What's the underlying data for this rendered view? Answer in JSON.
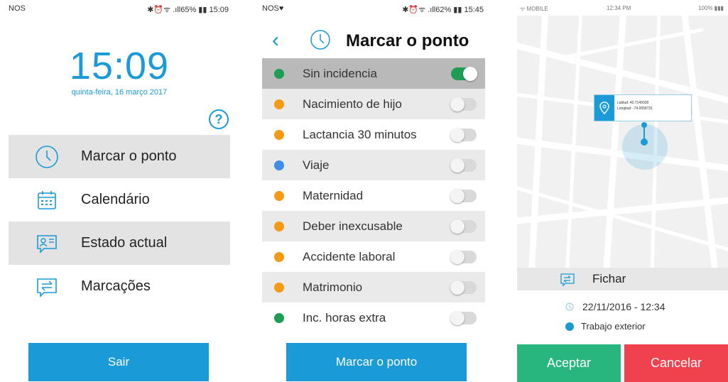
{
  "colors": {
    "accent": "#1a9ad6",
    "green": "#1f9d55",
    "orange": "#f59a14",
    "blue_dot": "#3e8eea",
    "accept": "#29b57e",
    "cancel": "#f0414f"
  },
  "phone1": {
    "status": {
      "carrier": "NOS",
      "right": "✱⏰ᯤ .ıll65% ▮▮ 15:09"
    },
    "time": "15:09",
    "date": "quinta-feira, 16 março 2017",
    "help_label": "?",
    "menu": [
      {
        "label": "Marcar o ponto",
        "icon": "clock-icon"
      },
      {
        "label": "Calendário",
        "icon": "calendar-icon"
      },
      {
        "label": "Estado actual",
        "icon": "user-card-icon"
      },
      {
        "label": "Marcações",
        "icon": "swap-icon"
      }
    ],
    "exit_label": "Sair"
  },
  "phone2": {
    "status": {
      "carrier": "NOS♥",
      "right": "✱⏰ᯤ .ıll62% ▮▮ 15:45"
    },
    "back_label": "‹",
    "title": "Marcar o ponto",
    "options": [
      {
        "label": "Sin incidencia",
        "color": "#1f9d55",
        "on": true
      },
      {
        "label": "Nacimiento de hijo",
        "color": "#f59a14",
        "on": false
      },
      {
        "label": "Lactancia 30 minutos",
        "color": "#f59a14",
        "on": false
      },
      {
        "label": "Viaje",
        "color": "#3e8eea",
        "on": false
      },
      {
        "label": "Maternidad",
        "color": "#f59a14",
        "on": false
      },
      {
        "label": "Deber inexcusable",
        "color": "#f59a14",
        "on": false
      },
      {
        "label": "Accidente laboral",
        "color": "#f59a14",
        "on": false
      },
      {
        "label": "Matrimonio",
        "color": "#f59a14",
        "on": false
      },
      {
        "label": "Inc. horas extra",
        "color": "#1f9d55",
        "on": false
      }
    ],
    "submit_label": "Marcar o ponto"
  },
  "phone3": {
    "status": {
      "carrier": "ᯤ MOBILE",
      "time": "12:34 PM",
      "battery": "100% ▮▮▮"
    },
    "popup": {
      "lat": "Latitud: 40.7140028",
      "lng": "Longitud: -74.0058731"
    },
    "fichar_label": "Fichar",
    "timestamp": "22/11/2016 - 12:34",
    "mode": "Trabajo exterior",
    "accept_label": "Aceptar",
    "cancel_label": "Cancelar"
  }
}
